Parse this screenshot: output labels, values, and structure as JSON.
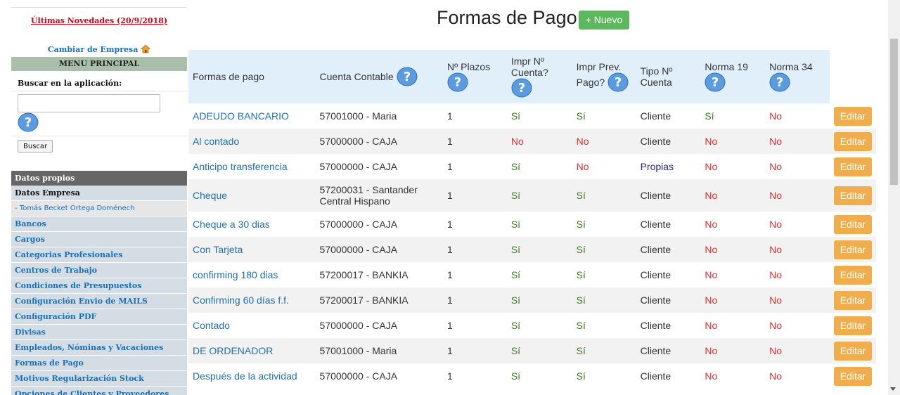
{
  "sidebar": {
    "news_link": "Últimas Novedades (20/9/2018)",
    "change_company": "Cambiar de Empresa",
    "menu_title": "MENU PRINCIPAL",
    "search_label": "Buscar en la aplicación:",
    "search_placeholder": "",
    "search_button": "Buscar",
    "section_title": "Datos propios",
    "items": [
      {
        "label": "Datos Empresa"
      },
      {
        "label": "- Tomás Becket Ortega Doménech"
      },
      {
        "label": "Bancos"
      },
      {
        "label": "Cargos"
      },
      {
        "label": "Categorias Profesionales"
      },
      {
        "label": "Centros de Trabajo"
      },
      {
        "label": "Condiciones de Presupuestos"
      },
      {
        "label": "Configuración Envio de MAILS"
      },
      {
        "label": "Configuración PDF"
      },
      {
        "label": "Divisas"
      },
      {
        "label": "Empleados, Nóminas y Vacaciones"
      },
      {
        "label": "Formas de Pago"
      },
      {
        "label": "Motivos Regularización Stock"
      },
      {
        "label": "Opciones de Clientes y Proveedores"
      }
    ]
  },
  "main": {
    "title": "Formas de Pago",
    "new_button": "+ Nuevo",
    "columns": {
      "name": "Formas de pago",
      "account": "Cuenta Contable",
      "terms": "Nº Plazos",
      "print_account_1": "Impr Nº",
      "print_account_2": "Cuenta?",
      "print_prev_1": "Impr Prev.",
      "print_prev_2": "Pago?",
      "account_type_1": "Tipo Nº",
      "account_type_2": "Cuenta",
      "norma19": "Norma 19",
      "norma34": "Norma 34"
    },
    "edit_label": "Editar",
    "rows": [
      {
        "name": "ADEUDO BANCARIO",
        "account_1": "57001000 - Maria",
        "account_2": "",
        "terms": "1",
        "print_account": "Sí",
        "print_prev": "Sí",
        "type": "Cliente",
        "n19": "Sí",
        "n34": "No"
      },
      {
        "name": "Al contado",
        "account_1": "57000000 - CAJA",
        "account_2": "",
        "terms": "1",
        "print_account": "No",
        "print_prev": "No",
        "type": "Cliente",
        "n19": "No",
        "n34": "No"
      },
      {
        "name": "Anticipo transferencia",
        "account_1": "57000000 - CAJA",
        "account_2": "",
        "terms": "1",
        "print_account": "Sí",
        "print_prev": "No",
        "type": "Propias",
        "n19": "No",
        "n34": "No"
      },
      {
        "name": "Cheque",
        "account_1": "57200031 - Santander",
        "account_2": "Central Hispano",
        "terms": "1",
        "print_account": "Sí",
        "print_prev": "Sí",
        "type": "Cliente",
        "n19": "No",
        "n34": "No"
      },
      {
        "name": "Cheque a 30 dias",
        "account_1": "57000000 - CAJA",
        "account_2": "",
        "terms": "1",
        "print_account": "Sí",
        "print_prev": "Sí",
        "type": "Cliente",
        "n19": "No",
        "n34": "No"
      },
      {
        "name": "Con Tarjeta",
        "account_1": "57000000 - CAJA",
        "account_2": "",
        "terms": "1",
        "print_account": "Sí",
        "print_prev": "Sí",
        "type": "Cliente",
        "n19": "No",
        "n34": "No"
      },
      {
        "name": "confirming 180 dias",
        "account_1": "57200017 - BANKIA",
        "account_2": "",
        "terms": "1",
        "print_account": "Sí",
        "print_prev": "Sí",
        "type": "Cliente",
        "n19": "No",
        "n34": "No"
      },
      {
        "name": "Confirming 60 días f.f.",
        "account_1": "57200017 - BANKIA",
        "account_2": "",
        "terms": "1",
        "print_account": "Sí",
        "print_prev": "Sí",
        "type": "Cliente",
        "n19": "No",
        "n34": "No"
      },
      {
        "name": "Contado",
        "account_1": "57000000 - CAJA",
        "account_2": "",
        "terms": "1",
        "print_account": "Sí",
        "print_prev": "Sí",
        "type": "Cliente",
        "n19": "No",
        "n34": "No"
      },
      {
        "name": "DE ORDENADOR",
        "account_1": "57001000 - Maria",
        "account_2": "",
        "terms": "1",
        "print_account": "Sí",
        "print_prev": "Sí",
        "type": "Cliente",
        "n19": "No",
        "n34": "No"
      },
      {
        "name": "Después de la actividad",
        "account_1": "57000000 - CAJA",
        "account_2": "",
        "terms": "1",
        "print_account": "Sí",
        "print_prev": "Sí",
        "type": "Cliente",
        "n19": "No",
        "n34": "No"
      }
    ]
  },
  "icons": {
    "help": "help-icon",
    "house": "house-icon"
  },
  "colors": {
    "yes": "#3c7a1e",
    "no": "#e32b2b",
    "new_button": "#5cb85c",
    "edit_button": "#f0ad4e",
    "header_bg": "#e1effb"
  }
}
